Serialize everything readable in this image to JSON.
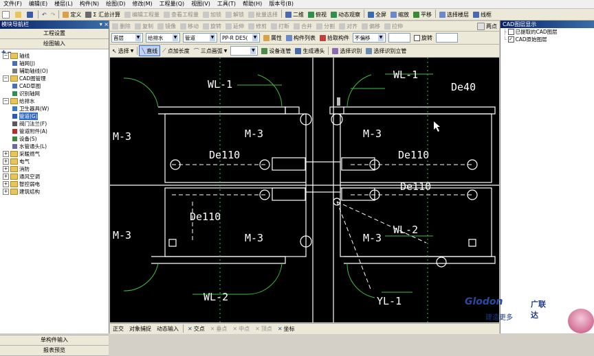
{
  "menu": [
    "文件(F)",
    "编辑(E)",
    "楼层(L)",
    "构件(N)",
    "绘图(D)",
    "修改(M)",
    "工程量(Q)",
    "视图(V)",
    "工具(T)",
    "帮助(H)",
    "版本号(B)"
  ],
  "toolbar1": {
    "items": [
      {
        "label": "定义",
        "icon": "define-icon",
        "enabled": true
      },
      {
        "label": "Σ 汇总计算",
        "icon": "sum-icon",
        "enabled": true
      },
      {
        "label": "编辑工程量",
        "icon": "edit-quantity-icon",
        "enabled": false
      },
      {
        "label": "查看工程量",
        "icon": "view-quantity-icon",
        "enabled": false
      },
      {
        "label": "加锁",
        "icon": "lock-icon",
        "enabled": false
      },
      {
        "label": "解锁",
        "icon": "unlock-icon",
        "enabled": false
      },
      {
        "label": "批量选择",
        "icon": "batch-select-icon",
        "enabled": false
      },
      {
        "label": "二维",
        "icon": "2d-icon",
        "enabled": true
      },
      {
        "label": "俯视",
        "icon": "top-view-icon",
        "enabled": true
      },
      {
        "label": "动态观察",
        "icon": "orbit-icon",
        "enabled": true
      },
      {
        "label": "全屏",
        "icon": "fullscreen-icon",
        "enabled": true
      },
      {
        "label": "缩放",
        "icon": "zoom-icon",
        "enabled": true
      },
      {
        "label": "平移",
        "icon": "pan-icon",
        "enabled": true
      },
      {
        "label": "选择楼层",
        "icon": "select-floor-icon",
        "enabled": true
      },
      {
        "label": "线框",
        "icon": "wireframe-icon",
        "enabled": true
      }
    ]
  },
  "left_panel": {
    "title": "模块导航栏",
    "buttons": [
      "工程设置",
      "绘图输入"
    ],
    "tree": [
      {
        "label": "轴线",
        "level": 0,
        "type": "folder",
        "expanded": true
      },
      {
        "label": "轴网(J)",
        "level": 1,
        "type": "item",
        "color": "#4a6fb0"
      },
      {
        "label": "辅助轴线(O)",
        "level": 1,
        "type": "item",
        "color": "#7a7a7a"
      },
      {
        "label": "CAD图管理",
        "level": 0,
        "type": "folder",
        "expanded": true
      },
      {
        "label": "CAD草图",
        "level": 1,
        "type": "item",
        "color": "#4a6fb0"
      },
      {
        "label": "识别轴网",
        "level": 1,
        "type": "item",
        "color": "#2f8f4f"
      },
      {
        "label": "给排水",
        "level": 0,
        "type": "folder",
        "expanded": true
      },
      {
        "label": "卫生器具(W)",
        "level": 1,
        "type": "item",
        "color": "#3a7ac0"
      },
      {
        "label": "管道(G)",
        "level": 1,
        "type": "item",
        "color": "#2a5caa",
        "selected": true
      },
      {
        "label": "阀门法兰(F)",
        "level": 1,
        "type": "item",
        "color": "#5a5a5a"
      },
      {
        "label": "管道附件(A)",
        "level": 1,
        "type": "item",
        "color": "#b03030"
      },
      {
        "label": "设备(S)",
        "level": 1,
        "type": "item",
        "color": "#3a8a3a"
      },
      {
        "label": "水管通头(L)",
        "level": 1,
        "type": "item",
        "color": "#6a6aa0"
      },
      {
        "label": "采暖燃气",
        "level": 0,
        "type": "folder",
        "expanded": false
      },
      {
        "label": "电气",
        "level": 0,
        "type": "folder",
        "expanded": false
      },
      {
        "label": "消防",
        "level": 0,
        "type": "folder",
        "expanded": false
      },
      {
        "label": "通风空调",
        "level": 0,
        "type": "folder",
        "expanded": false
      },
      {
        "label": "智控弱电",
        "level": 0,
        "type": "folder",
        "expanded": false
      },
      {
        "label": "建筑结构",
        "level": 0,
        "type": "folder",
        "expanded": false
      }
    ],
    "bottom_buttons": [
      "单构件输入",
      "报表预览"
    ]
  },
  "toolbar2": {
    "items": [
      "删除",
      "复制",
      "镜像",
      "移动",
      "旋转",
      "延伸",
      "修剪",
      "打断",
      "合并",
      "分割",
      "对齐",
      "偏移",
      "拉伸"
    ],
    "right": "两点"
  },
  "toolbar3": {
    "floor": "首层",
    "discipline": "给排水",
    "component": "管道",
    "pipe": "PP-R DE5(",
    "properties_btn": "属性",
    "component_list_btn": "构件列表",
    "pick_btn": "拾取构件",
    "offset": "不偏移",
    "rotate": "旋转"
  },
  "toolbar4": {
    "items": [
      "选择",
      "直线",
      "点加长度",
      "三点画弧",
      "设备连管",
      "生成通头",
      "选择识别",
      "选择识别立管"
    ]
  },
  "right_panel": {
    "title": "CAD图层显示",
    "layers": [
      {
        "label": "已提取的CAD图层",
        "checked": false
      },
      {
        "label": "CAD原始图层",
        "checked": true
      }
    ]
  },
  "cad": {
    "labels": [
      "WL-1",
      "WL-1",
      "De40",
      "M-3",
      "M-3",
      "M-3",
      "De110",
      "De110",
      "De110",
      "De110",
      "M-3",
      "M-3",
      "M-3",
      "WL-2",
      "WL-2",
      "YL-1"
    ]
  },
  "statusbar": {
    "items": [
      "正交",
      "对象捕捉",
      "动态输入",
      "交点",
      "垂点",
      "中点",
      "顶点",
      "坐标"
    ]
  },
  "logo": {
    "brand": "Glodon",
    "cn": "广联达",
    "slogan": "建造更多"
  },
  "colors": {
    "canvas_bg": "#000000",
    "wall": "#ffffff",
    "pipe": "#ffffff",
    "door": "#3fbf3f",
    "text": "#ffffff"
  }
}
